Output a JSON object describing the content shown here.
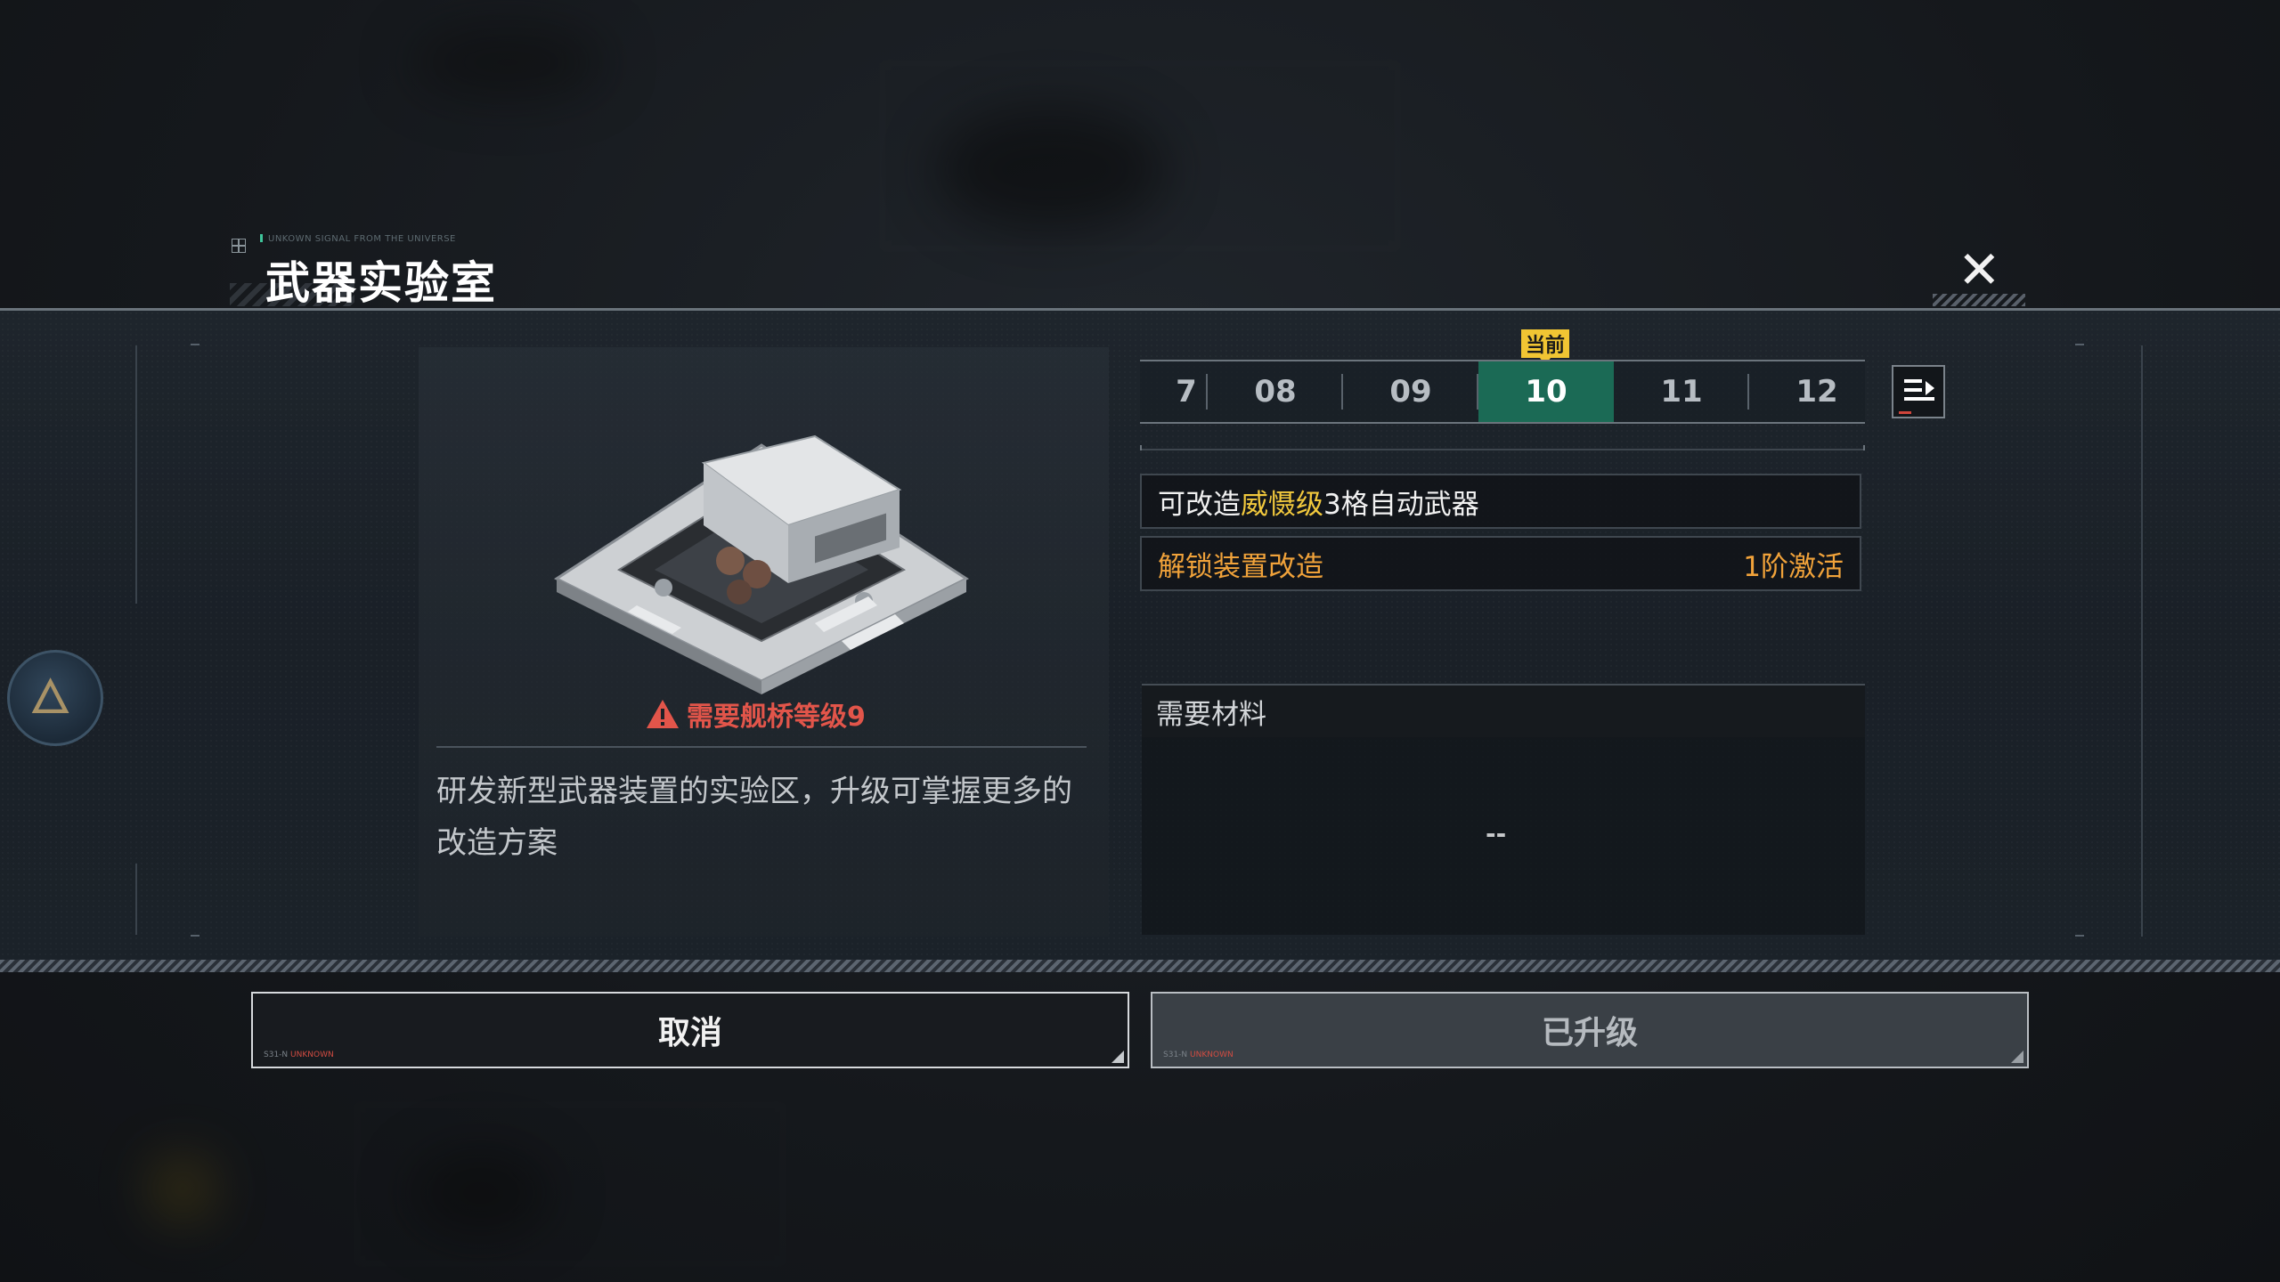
{
  "header": {
    "signal_text": "UNKOWN SIGNAL FROM THE UNIVERSE",
    "title": "武器实验室",
    "close_icon": "close-x-icon"
  },
  "module": {
    "requirement": "需要舰桥等级9",
    "description": "研发新型武器装置的实验区，升级可掌握更多的改造方案"
  },
  "levels": {
    "current_badge": "当前",
    "tabs": [
      {
        "label": "7"
      },
      {
        "label": "08"
      },
      {
        "label": "09"
      },
      {
        "label": "10",
        "current": true
      },
      {
        "label": "11"
      },
      {
        "label": "12"
      }
    ]
  },
  "features": {
    "row1": {
      "prefix": "可改造",
      "highlight": "威慑级",
      "suffix": "3格自动武器"
    },
    "row2": {
      "label": "解锁装置改造",
      "value": "1阶激活"
    }
  },
  "materials": {
    "header": "需要材料",
    "empty": "--"
  },
  "buttons": {
    "cancel": "取消",
    "upgraded": "已升级",
    "tag_code": "S31-N",
    "tag_sub": "UNKNOWN"
  },
  "colors": {
    "current_tab": "#1b6a55",
    "badge": "#f1c533",
    "warning": "#e2554a",
    "highlight_yellow": "#f2c93d",
    "highlight_orange": "#f0a23a"
  }
}
